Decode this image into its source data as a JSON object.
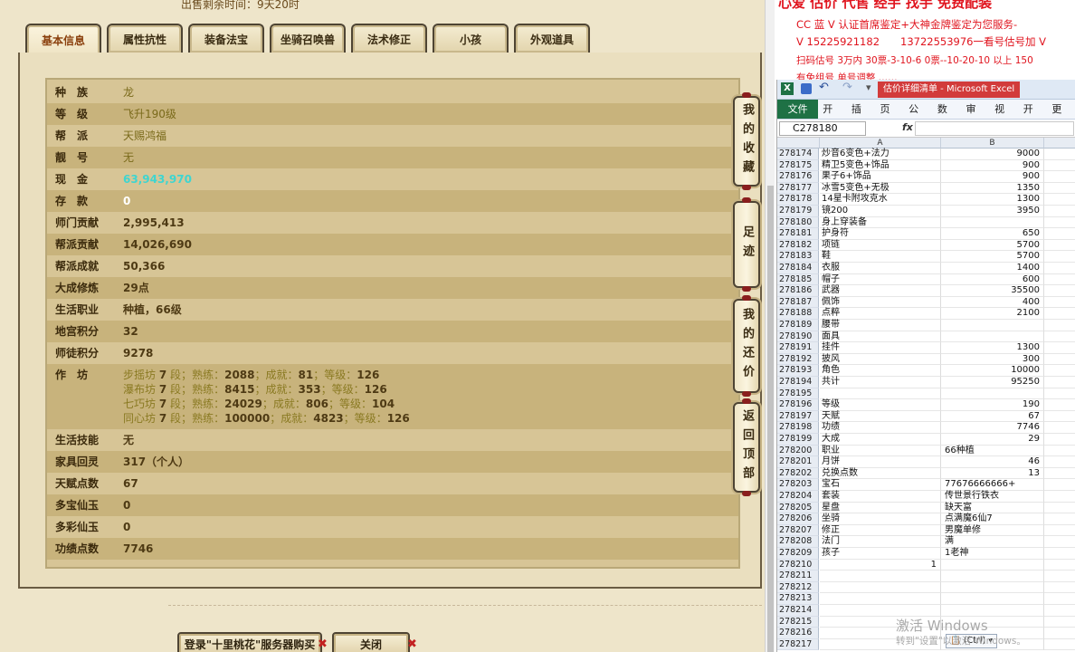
{
  "game": {
    "top_note": "出售剩余时间：9天20时",
    "tabs": [
      "基本信息",
      "属性抗性",
      "装备法宝",
      "坐骑召唤兽",
      "法术修正",
      "小孩",
      "外观道具"
    ],
    "rows": [
      {
        "label": "种　族",
        "value": "龙"
      },
      {
        "label": "等　级",
        "value": "飞升190级"
      },
      {
        "label": "帮　派",
        "value": "天赐鸿福"
      },
      {
        "label": "靓　号",
        "value": "无"
      },
      {
        "label": "现　金",
        "value": "63,943,970"
      },
      {
        "label": "存　款",
        "value": "0"
      },
      {
        "label": "师门贡献",
        "value": "2,995,413"
      },
      {
        "label": "帮派贡献",
        "value": "14,026,690"
      },
      {
        "label": "帮派成就",
        "value": "50,366"
      },
      {
        "label": "大成修炼",
        "value": "29点"
      },
      {
        "label": "生活职业",
        "value": "种植，66级"
      },
      {
        "label": "地宫积分",
        "value": "32"
      },
      {
        "label": "师徒积分",
        "value": "9278"
      },
      {
        "label": "作　坊",
        "value": ""
      },
      {
        "label": "生活技能",
        "value": "无"
      },
      {
        "label": "家具回灵",
        "value": "317（个人）"
      },
      {
        "label": "天赋点数",
        "value": "67"
      },
      {
        "label": "多宝仙玉",
        "value": "0"
      },
      {
        "label": "多彩仙玉",
        "value": "0"
      },
      {
        "label": "功绩点数",
        "value": "7746"
      }
    ],
    "workshop": [
      {
        "name": "步摇坊",
        "level": "7",
        "proficiency": "2088",
        "achievement": "81",
        "grade": "126"
      },
      {
        "name": "瀑布坊",
        "level": "7",
        "proficiency": "8415",
        "achievement": "353",
        "grade": "126"
      },
      {
        "name": "七巧坊",
        "level": "7",
        "proficiency": "24029",
        "achievement": "806",
        "grade": "104"
      },
      {
        "name": "同心坊",
        "level": "7",
        "proficiency": "100000",
        "achievement": "4823",
        "grade": "126"
      }
    ],
    "workshop_words": {
      "seg": "段",
      "prof": "熟练",
      "ach": "成就",
      "grade": "等级"
    },
    "side_buttons": [
      "我的收藏",
      "足迹",
      "我的还价",
      "返回顶部"
    ],
    "bottom_buttons": {
      "login": "登录\"十里桃花\"服务器购买",
      "close": "关闭"
    }
  },
  "ad": {
    "line1": "心爱 估价 代售 经手 找手 免费配装",
    "line2": "CC 蓝 V 认证首席鉴定+大神金牌鉴定为您服务-",
    "line3": "V 15225921182　　13722553976一看号估号加 V",
    "line4": "扫码估号 3万内 30票-3-10-6 0票--10-20-10 以上 150",
    "line5": "有免组号 单号调整 ……"
  },
  "excel": {
    "title": "估价详细清单 - Microsoft Excel",
    "tabs": [
      "文件",
      "开始",
      "插入",
      "页面",
      "公式",
      "数据",
      "审阅",
      "视图",
      "开发",
      "更多"
    ],
    "name_box": "C278180",
    "fx": "fx",
    "col_a": "A",
    "col_b": "B",
    "rows": [
      [
        "278174",
        "炒音6变色+法力",
        "9000"
      ],
      [
        "278175",
        "精卫5变色+饰品",
        "900"
      ],
      [
        "278176",
        "果子6+饰品",
        "900"
      ],
      [
        "278177",
        "冰雪5变色+无极",
        "1350"
      ],
      [
        "278178",
        "14星卡附攻克水",
        "1300"
      ],
      [
        "278179",
        "镜200",
        "3950"
      ],
      [
        "278180",
        "身上穿装备",
        ""
      ],
      [
        "278181",
        "护身符",
        "650"
      ],
      [
        "278182",
        "项链",
        "5700"
      ],
      [
        "278183",
        "鞋",
        "5700"
      ],
      [
        "278184",
        "衣服",
        "1400"
      ],
      [
        "278185",
        "帽子",
        "600"
      ],
      [
        "278186",
        "武器",
        "35500"
      ],
      [
        "278187",
        "佩饰",
        "400"
      ],
      [
        "278188",
        "点粹",
        "2100"
      ],
      [
        "278189",
        "腰带",
        ""
      ],
      [
        "278190",
        "面具",
        ""
      ],
      [
        "278191",
        "挂件",
        "1300"
      ],
      [
        "278192",
        "披风",
        "300"
      ],
      [
        "278193",
        "角色",
        "10000"
      ],
      [
        "278194",
        "共计",
        "95250"
      ],
      [
        "278195",
        "",
        ""
      ],
      [
        "278196",
        "等级",
        "190"
      ],
      [
        "278197",
        "天赋",
        "67"
      ],
      [
        "278198",
        "功绩",
        "7746"
      ],
      [
        "278199",
        "大成",
        "29"
      ],
      [
        "278200",
        "职业",
        "66种植"
      ],
      [
        "278201",
        "月饼",
        "46"
      ],
      [
        "278202",
        "兑换点数",
        "13"
      ],
      [
        "278203",
        "宝石",
        "77676666666+"
      ],
      [
        "278204",
        "套装",
        "传世景行铁衣"
      ],
      [
        "278205",
        "星盘",
        "缺天富"
      ],
      [
        "278206",
        "坐骑",
        "点满魔6仙7"
      ],
      [
        "278207",
        "修正",
        "男魔单修"
      ],
      [
        "278208",
        "法门",
        "满"
      ],
      [
        "278209",
        "孩子",
        "1老神"
      ],
      [
        "278210",
        "1",
        ""
      ],
      [
        "278211",
        "",
        ""
      ],
      [
        "278212",
        "",
        ""
      ],
      [
        "278213",
        "",
        ""
      ],
      [
        "278214",
        "",
        ""
      ],
      [
        "278215",
        "",
        ""
      ],
      [
        "278216",
        "",
        ""
      ],
      [
        "278217",
        "",
        ""
      ]
    ],
    "paste_tag": "(Ctrl) ▾",
    "watermark1": "激活 Windows",
    "watermark2": "转到\"设置\"以激活 Windows。"
  }
}
